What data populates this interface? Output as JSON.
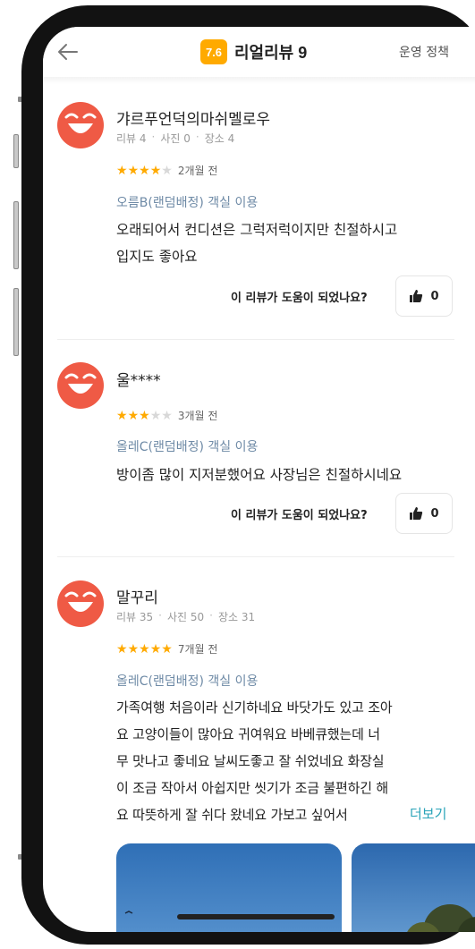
{
  "header": {
    "score": "7.6",
    "title": "리얼리뷰 9",
    "policy": "운영 정책"
  },
  "helpful_question": "이 리뷰가 도움이 되었나요?",
  "more_label": "더보기",
  "colors": {
    "accent": "#ffaa00",
    "avatar": "#ef5a45",
    "room_text": "#6e8aa6",
    "more_link": "#29a3b8"
  },
  "reviews": [
    {
      "nickname": "갸르푸언덕의마쉬멜로우",
      "meta": [
        "리뷰 4",
        "사진 0",
        "장소 4"
      ],
      "stars": 4,
      "date": "2개월 전",
      "room": "오름B(랜덤배정) 객실 이용",
      "text_lines": [
        "오래되어서 컨디션은 그럭저럭이지만 친절하시고",
        "입지도 좋아요"
      ],
      "likes": "0"
    },
    {
      "nickname": "울****",
      "meta": [],
      "stars": 3,
      "date": "3개월 전",
      "room": "올레C(랜덤배정) 객실 이용",
      "text_lines": [
        "방이좀 많이 지저분했어요 사장님은 친절하시네요"
      ],
      "likes": "0"
    },
    {
      "nickname": "말꾸리",
      "meta": [
        "리뷰 35",
        "사진 50",
        "장소 31"
      ],
      "stars": 5,
      "date": "7개월 전",
      "room": "올레C(랜덤배정) 객실 이용",
      "text_lines": [
        "가족여행  처음이라 신기하네요 바닷가도 있고 조아",
        "요  고양이들이 많아요 귀여워요  바베큐했는데 너",
        "무 맛나고 좋네요  날씨도좋고  잘 쉬었네요  화장실",
        "이 조금 작아서 아쉽지만  씻기가  조금  불편하긴 해",
        "요 따뜻하게  잘 쉬다 왔네요   가보고 싶어서"
      ]
    }
  ]
}
